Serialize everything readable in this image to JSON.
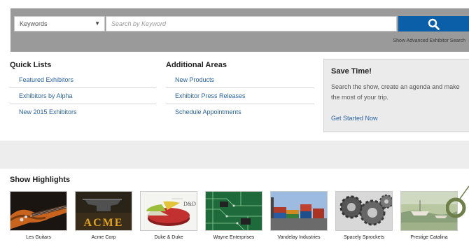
{
  "search": {
    "select_value": "Keywords",
    "placeholder": "Search by Keyword",
    "advanced_link": "Show Advanced Exhibitor Search"
  },
  "quick_lists": {
    "title": "Quick Lists",
    "items": [
      "Featured Exhibitors",
      "Exhibitors by Alpha",
      "New 2015 Exhibitors"
    ]
  },
  "additional_areas": {
    "title": "Additional Areas",
    "items": [
      "New Products",
      "Exhibitor Press Releases",
      "Schedule Appointments"
    ]
  },
  "save_time": {
    "title": "Save Time!",
    "body": "Search the show, create an agenda and make the most of your trip.",
    "cta": "Get Started Now"
  },
  "highlights": {
    "title": "Show Highlights",
    "tiles": [
      {
        "caption": "Les Guitars",
        "icon": "guitar-image"
      },
      {
        "caption": "Acme Corp",
        "icon": "anvil-image",
        "logo_text": "ACME"
      },
      {
        "caption": "Duke & Duke",
        "icon": "pie-chart-image",
        "logo_text": "D&D"
      },
      {
        "caption": "Wayne Enterprises",
        "icon": "circuit-board-image"
      },
      {
        "caption": "Vandelay Industries",
        "icon": "shipping-containers-image"
      },
      {
        "caption": "Spacely Sprockets",
        "icon": "gears-image"
      },
      {
        "caption": "Prestige Catalina",
        "icon": "harbor-painting-image"
      }
    ]
  },
  "colors": {
    "accent": "#0a5fa8",
    "link": "#2a63a0",
    "panel": "#9a9a9a",
    "ring": "#6e7f4a"
  }
}
